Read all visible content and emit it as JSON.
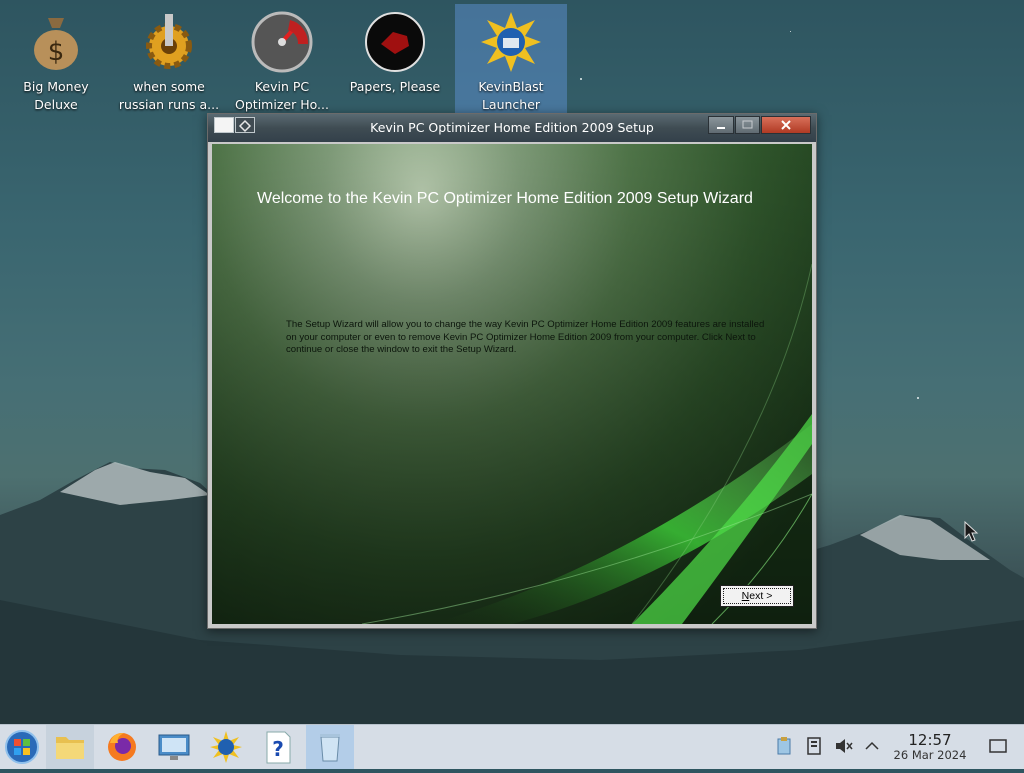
{
  "desktop": {
    "icons": [
      {
        "label": "Big Money\nDeluxe",
        "icon": "money-bag-icon"
      },
      {
        "label": "when some\nrussian runs a...",
        "icon": "gear-icon"
      },
      {
        "label": "Kevin PC\nOptimizer Ho...",
        "icon": "gauge-icon"
      },
      {
        "label": "Papers, Please",
        "icon": "papers-please-icon"
      },
      {
        "label": "KevinBlast\nLauncher",
        "icon": "kevinblast-icon",
        "selected": true
      }
    ]
  },
  "window": {
    "title": "Kevin PC Optimizer Home Edition 2009 Setup",
    "welcome": "Welcome to the Kevin PC Optimizer Home Edition 2009 Setup Wizard",
    "description": "The Setup Wizard will allow you to change the way Kevin PC Optimizer Home Edition 2009 features are installed on your computer or even to remove Kevin PC Optimizer Home Edition 2009 from your computer.  Click Next to continue or close the window to exit the Setup Wizard.",
    "next_button": {
      "accesskey": "N",
      "rest": "ext >"
    }
  },
  "taskbar": {
    "items": [
      "start-icon",
      "file-manager-icon",
      "firefox-icon",
      "control-panel-icon",
      "kevinblast-icon",
      "help-icon",
      "recycle-bin-icon"
    ],
    "tray": [
      "clipboard-icon",
      "storage-icon",
      "volume-muted-icon",
      "chevron-up-icon"
    ],
    "time": "12:57",
    "date": "26 Mar 2024"
  },
  "colors": {
    "accent_selected": "#5a8cc8",
    "taskbar_bg": "#d6dde6",
    "wizard_green": "#30562c"
  }
}
